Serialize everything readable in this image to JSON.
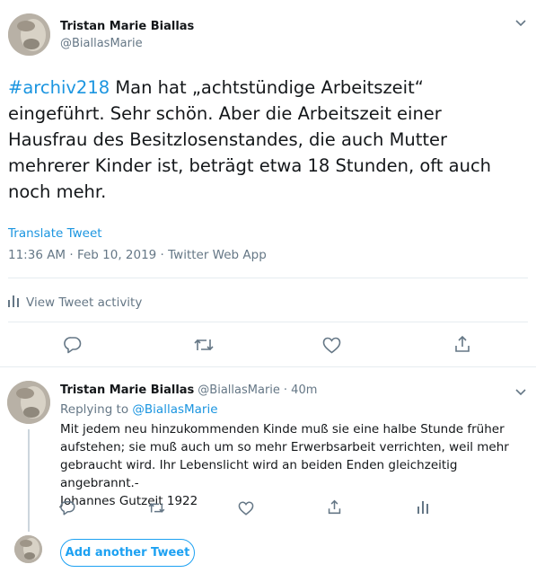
{
  "main_tweet": {
    "author_name": "Tristan Marie Biallas",
    "author_handle": "@BiallasMarie",
    "hashtag": "#archiv218",
    "text": " Man hat „achtstündige Arbeitszeit“\neingeführt. Sehr schön. Aber die Arbeitszeit einer\nHausfrau des Besitzlosenstandes, die auch Mutter\nmehrerer Kinder ist, beträgt etwa 18 Stunden, oft auch\nnoch mehr.",
    "translate_label": "Translate Tweet",
    "timestamp": "11:36 AM · Feb 10, 2019 · Twitter Web App",
    "activity_label": "View Tweet activity"
  },
  "reply_tweet": {
    "author_name": "Tristan Marie Biallas",
    "author_handle": "@BiallasMarie",
    "time": "· 40m",
    "replying_prefix": "Replying to",
    "replying_to": "@BiallasMarie",
    "text": "Mit jedem neu hinzukommenden Kinde muß sie eine halbe Stunde früher\naufstehen; sie muß auch um so mehr Erwerbsarbeit verrichten, weil mehr\ngebraucht wird. Ihr Lebenslicht wird an beiden Enden gleichzeitig angebrannt.-\nJohannes Gutzeit 1922"
  },
  "composer": {
    "add_tweet_label": "Add another Tweet"
  },
  "icons": [
    "chevron-down-icon",
    "reply-icon",
    "retweet-icon",
    "like-icon",
    "share-icon",
    "analytics-icon"
  ],
  "colors": {
    "link": "#1b95e0",
    "secondary_text": "#657786",
    "divider": "#e6ecf0",
    "button_accent": "#1da1f2"
  }
}
